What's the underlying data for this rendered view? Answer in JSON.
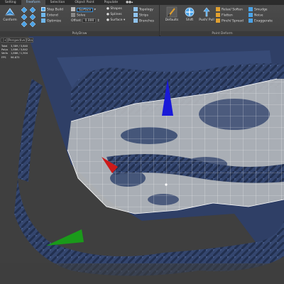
{
  "tabs": [
    {
      "label": "Selting",
      "active": false
    },
    {
      "label": "Freeform",
      "active": true
    },
    {
      "label": "Selection",
      "active": false
    },
    {
      "label": "Object Paint",
      "active": false
    },
    {
      "label": "Populate",
      "active": false
    }
  ],
  "ribbon": {
    "polydraw": {
      "panel_label": "PolyDraw",
      "conform_label": "Conform",
      "step_build": "Step Build",
      "extend": "Extend",
      "optimize": "Optimize",
      "surface_dropdown": "Surface",
      "offset_label": "Offset",
      "offset_value": "0.000",
      "shapes": "Shapes",
      "splines": "Splines",
      "surface_radio": "Surface",
      "topology": "Topology",
      "strips": "Strips",
      "branches": "Branches",
      "solve_label": "Solve"
    },
    "paint_deform": {
      "panel_label": "Paint Deform",
      "defaults": "Defaults",
      "shift": "Shift",
      "push_pull": "Push/ Pull",
      "relax_soften": "Relax/ Soften",
      "flatten": "Flatten",
      "pinch_spread": "Pinch/ Spread",
      "smudge": "Smudge",
      "noise": "Noise",
      "exaggerate": "Exaggerate"
    }
  },
  "viewport": {
    "label": "[+][Perspective][Shaded]",
    "stats": [
      {
        "key": "Total",
        "value": "3,389 / 3,840"
      },
      {
        "key": "Polys",
        "value": "1,886 / 3,842"
      },
      {
        "key": "Verts",
        "value": "1,886 / 1,904"
      },
      {
        "key": "FPS",
        "value": "96.875"
      }
    ]
  },
  "colors": {
    "mesh": "#34466f",
    "mesh_shadow": "#1c2742",
    "retopo_surface": "#aeb1b5",
    "wire": "#ffffff",
    "gizmo_z": "#1a1ad8",
    "gizmo_x": "#cc1a1a",
    "gizmo_y": "#1a9a1a",
    "ui_accent": "#3d8fd6"
  },
  "icons": {
    "conform": "conform-icon",
    "step_build": "step-build-icon",
    "shift": "shift-icon",
    "push_pull": "push-pull-icon",
    "defaults": "brush-defaults-icon"
  }
}
